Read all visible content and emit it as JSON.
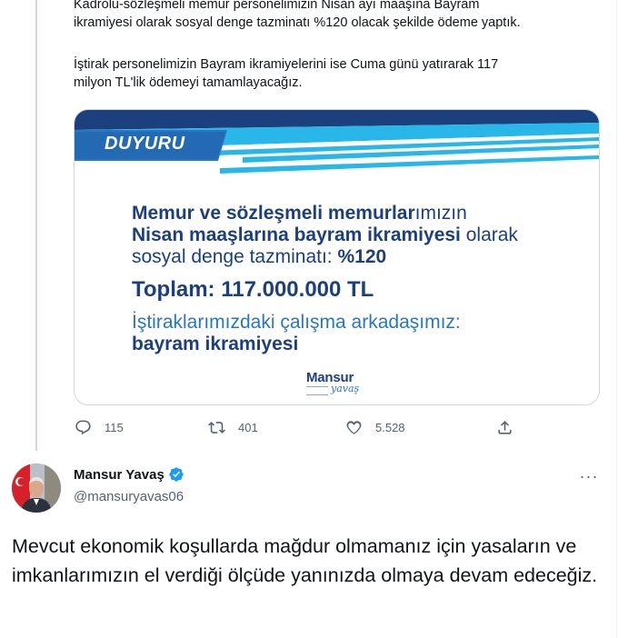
{
  "tweet1": {
    "paragraph1_lines": [
      "Kadrolu-sözleşmeli memur personelimizin Nisan ayı maaşına Bayram",
      "ikramiyesi olarak sosyal denge tazminatı %120 olacak şekilde ödeme yaptık."
    ],
    "paragraph2_lines": [
      "İştirak personelimizin Bayram ikramiyelerini ise Cuma günü yatırarak 117",
      "milyon TL'lik ödemeyi tamamlayacağız."
    ],
    "card": {
      "badge": "DUYURU",
      "line1_bold": "Memur ve sözleşmeli memurlar",
      "line1_rest": "ımızın",
      "line2_bold": "Nisan maaşlarına bayram ikramiyesi",
      "line2_rest": " olarak",
      "line3_rest": "sosyal denge tazminatı: ",
      "line3_bold": "%120",
      "total": "Toplam: 117.000.000 TL",
      "line5": "İştiraklarımızdaki çalışma arkadaşımız:",
      "line6": "bayram ikramiyesi",
      "logo_word": "Mansur",
      "logo_script": "yavaş"
    },
    "actions": {
      "replies": "115",
      "retweets": "401",
      "likes": "5.528"
    }
  },
  "tweet2": {
    "author_name": "Mansur Yavaş",
    "author_handle": "@mansuryavas06",
    "more_label": "···",
    "text": "Mevcut ekonomik koşullarda mağdur olmamanız için yasaların ve imkanlarımızın el verdiği ölçüde yanınızda olmaya devam edeceğiz."
  },
  "colors": {
    "navy": "#1c3f7e",
    "light_blue": "#2777c6",
    "cyan": "#29b6e8",
    "twitter_blue": "#1d9bf0",
    "muted": "#536471"
  },
  "icons": [
    "reply-icon",
    "retweet-icon",
    "like-icon",
    "share-icon",
    "verified-badge-icon",
    "more-icon"
  ]
}
